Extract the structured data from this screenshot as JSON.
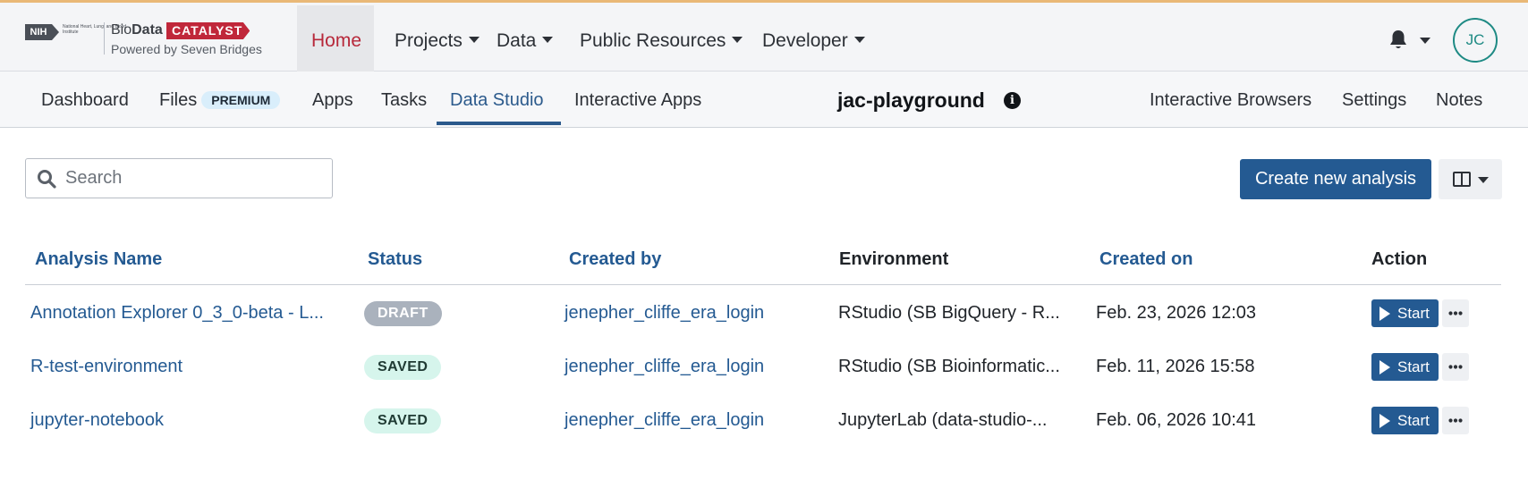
{
  "header": {
    "logo": {
      "nih": "NIH",
      "nih_sub": "National Heart, Lung, and Blood Institute",
      "bio": "Bio",
      "data": "Data",
      "catalyst": "CATALYST",
      "subtitle": "Powered by Seven Bridges"
    },
    "nav": [
      {
        "label": "Home",
        "active": true
      },
      {
        "label": "Projects",
        "has_dropdown": true
      },
      {
        "label": "Data",
        "has_dropdown": true
      },
      {
        "label": "Public Resources",
        "has_dropdown": true
      },
      {
        "label": "Developer",
        "has_dropdown": true
      }
    ],
    "user_initials": "JC",
    "icons": {
      "notifications": "bell-icon",
      "notifications_menu": "chevron-down-icon"
    }
  },
  "subnav": {
    "left": [
      {
        "label": "Dashboard"
      },
      {
        "label": "Files",
        "badge": "PREMIUM"
      },
      {
        "label": "Apps"
      },
      {
        "label": "Tasks"
      },
      {
        "label": "Data Studio",
        "active": true
      },
      {
        "label": "Interactive Apps"
      }
    ],
    "project_name": "jac-playground",
    "info_glyph": "i",
    "right": [
      {
        "label": "Interactive Browsers"
      },
      {
        "label": "Settings"
      },
      {
        "label": "Notes"
      }
    ]
  },
  "toolbar": {
    "search_placeholder": "Search",
    "create_label": "Create new analysis",
    "columns_icon": "columns-icon"
  },
  "table": {
    "headers": [
      "Analysis Name",
      "Status",
      "Created by",
      "Environment",
      "Created on",
      "Action"
    ],
    "rows": [
      {
        "name": "Annotation Explorer 0_3_0-beta - L...",
        "status": "DRAFT",
        "created_by": "jenepher_cliffe_era_login",
        "environment": "RStudio (SB BigQuery - R...",
        "created_on": "Feb. 23, 2026 12:03",
        "action": "Start"
      },
      {
        "name": "R-test-environment",
        "status": "SAVED",
        "created_by": "jenepher_cliffe_era_login",
        "environment": "RStudio (SB Bioinformatic...",
        "created_on": "Feb. 11, 2026 15:58",
        "action": "Start"
      },
      {
        "name": "jupyter-notebook",
        "status": "SAVED",
        "created_by": "jenepher_cliffe_era_login",
        "environment": "JupyterLab (data-studio-...",
        "created_on": "Feb. 06, 2026 10:41",
        "action": "Start"
      }
    ]
  },
  "colors": {
    "brand_red": "#c0273a",
    "link_blue": "#245a92",
    "teal": "#1e8a84",
    "draft_bg": "#aab2bd",
    "saved_bg": "#d6f5ec"
  }
}
